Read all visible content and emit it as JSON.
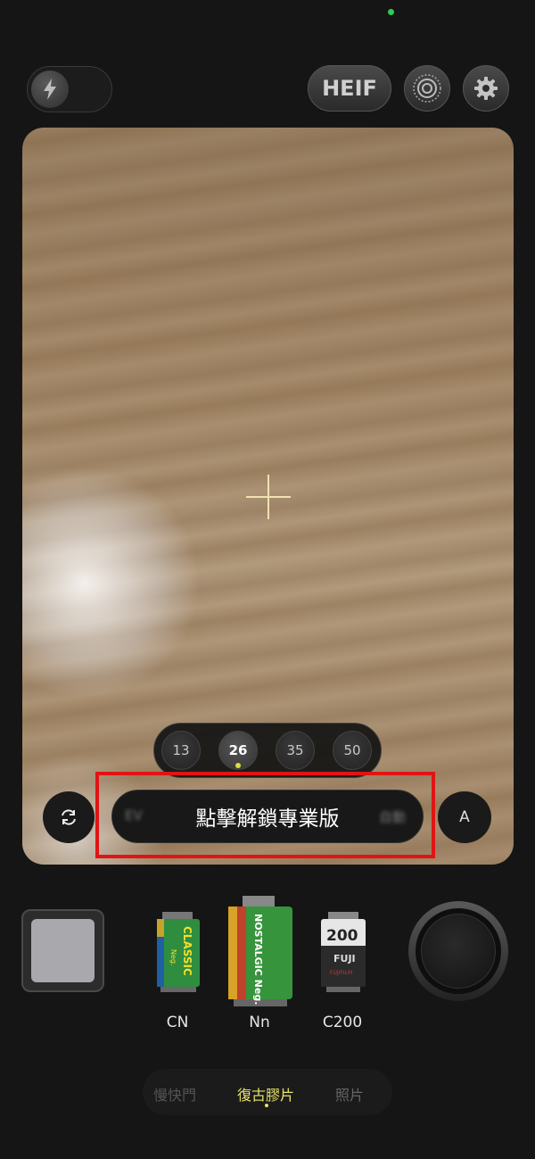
{
  "top_bar": {
    "format_label": "HEIF"
  },
  "focal_lengths": [
    "13",
    "26",
    "35",
    "50"
  ],
  "focal_active": "26",
  "unlock_label": "點擊解鎖專業版",
  "blur_left": "EV",
  "blur_right": "自動",
  "auto_label": "A",
  "films": [
    {
      "label": "CN",
      "brand_text": "CLASSIC",
      "sub": "Neg."
    },
    {
      "label": "Nn",
      "brand_text": "NOSTALGIC Neg."
    },
    {
      "label": "C200",
      "brand_text": "200",
      "sub": "FUJI",
      "small": "FUJIFILM"
    }
  ],
  "modes": [
    "慢快門",
    "復古膠片",
    "照片"
  ],
  "active_mode": "復古膠片",
  "colors": {
    "accent": "#e8e36a",
    "highlight": "#e01414"
  }
}
